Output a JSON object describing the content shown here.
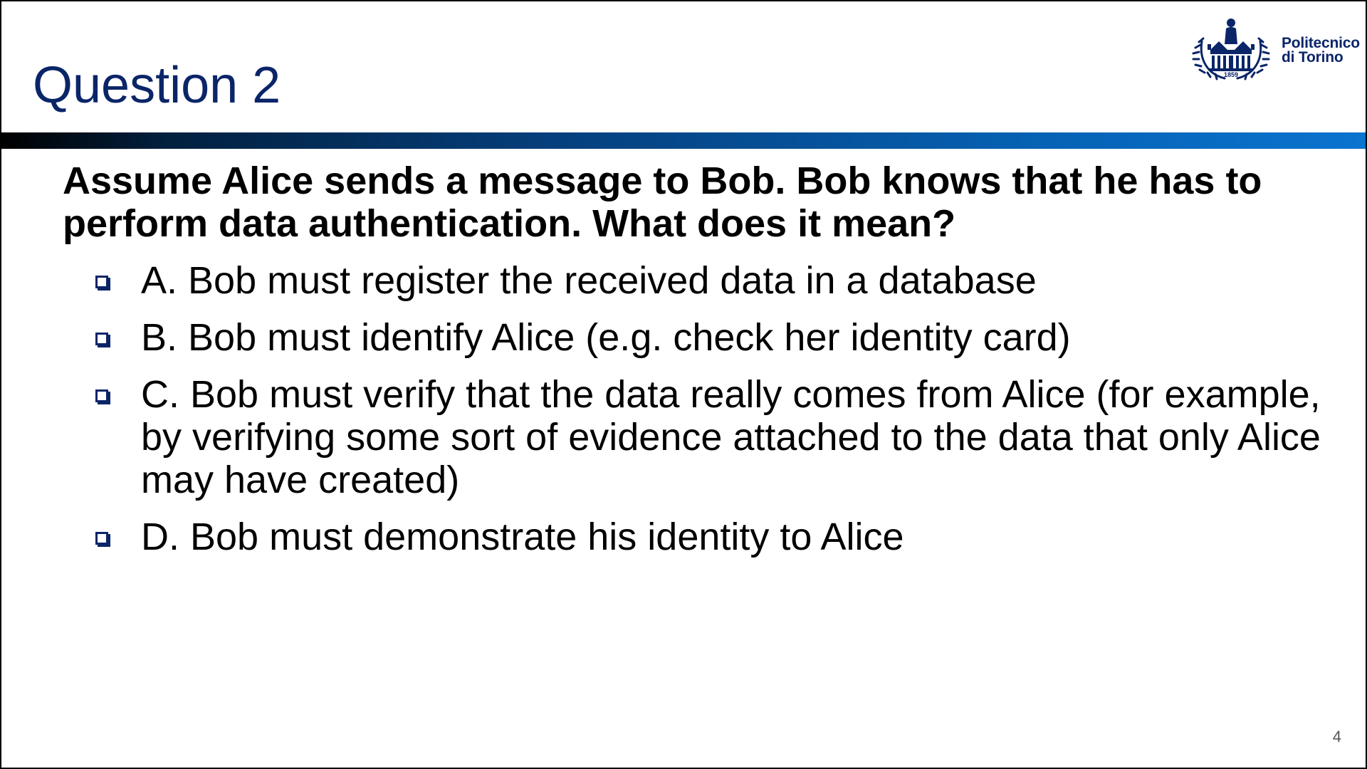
{
  "slide": {
    "title": "Question 2",
    "page_number": "4"
  },
  "logo": {
    "line1": "Politecnico",
    "line2": "di Torino",
    "year": "1859"
  },
  "question": {
    "text": "Assume Alice sends a message to Bob. Bob knows that he has to perform data authentication. What does it mean?"
  },
  "options": [
    {
      "label": "A. Bob must register the received data in a database"
    },
    {
      "label": "B. Bob must identify Alice (e.g. check her identity card)"
    },
    {
      "label": "C. Bob must verify that the data really comes from Alice (for example, by verifying some sort of evidence attached to the data that only Alice may have created)"
    },
    {
      "label": "D. Bob must demonstrate his identity to Alice"
    }
  ],
  "colors": {
    "title": "#0a2568",
    "bullet": "#0a2568",
    "bar_start": "#000000",
    "bar_end": "#0a74cf"
  },
  "icons": {
    "bullet": "hollow-square-bullet-icon",
    "logo": "politecnico-torino-seal-icon"
  }
}
